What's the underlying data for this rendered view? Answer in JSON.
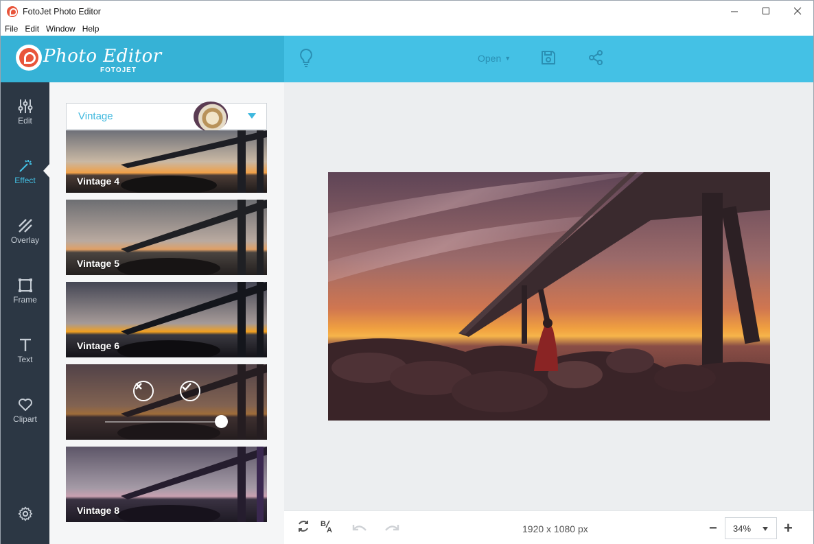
{
  "window": {
    "title": "FotoJet Photo Editor",
    "controls": [
      "minimize-icon",
      "maximize-icon",
      "close-icon"
    ]
  },
  "menu": [
    "File",
    "Edit",
    "Window",
    "Help"
  ],
  "header": {
    "logo_title": "Photo Editor",
    "logo_sub": "FOTOJET",
    "open_label": "Open",
    "icons": [
      "lightbulb-icon",
      "save-icon",
      "share-icon"
    ]
  },
  "nav": {
    "items": [
      {
        "label": "Edit",
        "icon": "sliders-icon"
      },
      {
        "label": "Effect",
        "icon": "magic-wand-icon",
        "active": true
      },
      {
        "label": "Overlay",
        "icon": "overlay-icon"
      },
      {
        "label": "Frame",
        "icon": "frame-icon"
      },
      {
        "label": "Text",
        "icon": "text-icon"
      },
      {
        "label": "Clipart",
        "icon": "heart-icon"
      }
    ],
    "settings_icon": "gear-icon"
  },
  "panel": {
    "category": "Vintage",
    "effects": [
      {
        "label": "Vintage 4"
      },
      {
        "label": "Vintage 5"
      },
      {
        "label": "Vintage 6"
      },
      {
        "label": "",
        "editing": true,
        "intensity": 1.0
      },
      {
        "label": "Vintage 8"
      }
    ]
  },
  "canvas": {
    "dimensions": "1920 x 1080 px"
  },
  "bottom": {
    "zoom": "34%",
    "icons": [
      "reset-icon",
      "compare-icon",
      "undo-icon",
      "redo-icon"
    ]
  },
  "colors": {
    "accent": "#44c1e5",
    "header_left": "#36b2d6",
    "nav_bg": "#2c3744",
    "logo_red": "#e8553b"
  }
}
